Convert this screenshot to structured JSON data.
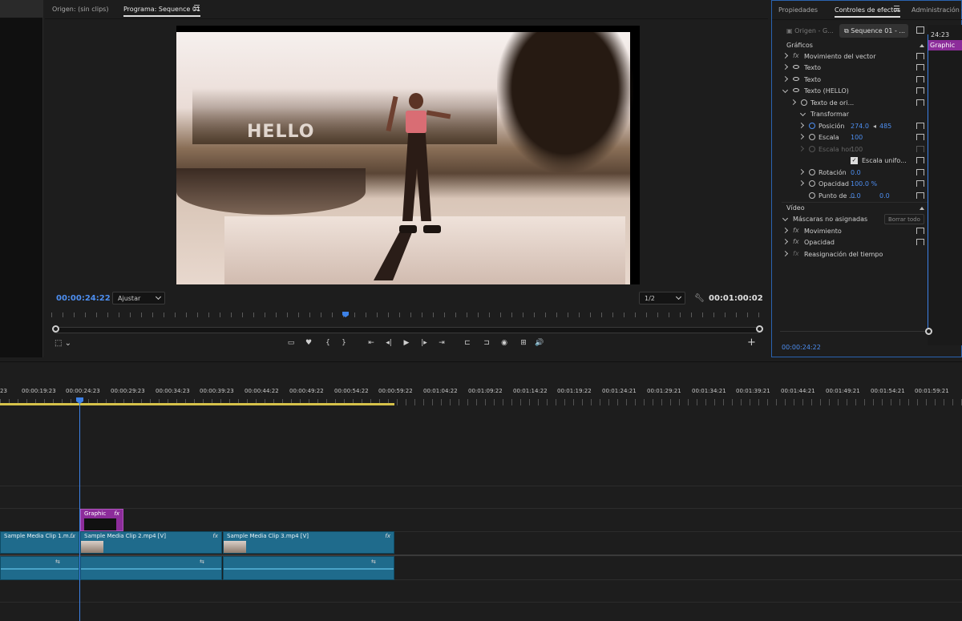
{
  "program": {
    "source_tab": "Origen: (sin clips)",
    "program_tab": "Programa: Sequence 01",
    "overlay_text": "HELLO",
    "current_time": "00:00:24:22",
    "fit_select": "Ajustar",
    "resolution_select": "1/2",
    "duration": "00:01:00:02",
    "controls": [
      "▭",
      "♥",
      "{",
      "}",
      "⇤",
      "◂|",
      "▶",
      "|▸",
      "⇥",
      "⊏",
      "⊐",
      "◉",
      "⊞",
      "🔊"
    ]
  },
  "effects": {
    "tabs": {
      "properties": "Propiedades",
      "effect_controls": "Controles de efectos",
      "admin": "Administración de"
    },
    "sub_source": "Origen - G...",
    "sub_sequence": "Sequence 01 - ...",
    "section_graphics": "Gráficos",
    "rows": [
      {
        "label": "Movimiento del vector"
      },
      {
        "label": "Texto"
      },
      {
        "label": "Texto"
      },
      {
        "label": "Texto (HELLO)"
      },
      {
        "label": "Texto de ori..."
      },
      {
        "label": "Transformar"
      },
      {
        "label": "Posición",
        "v1": "274.0",
        "v2": "485"
      },
      {
        "label": "Escala",
        "v1": "100"
      },
      {
        "label": "Escala hor...",
        "v1": "100"
      },
      {
        "label": "Escala unifo..."
      },
      {
        "label": "Rotación",
        "v1": "0.0"
      },
      {
        "label": "Opacidad",
        "v1": "100.0 %"
      },
      {
        "label": "Punto de ...",
        "v1": "0.0",
        "v2": "0.0"
      }
    ],
    "section_video": "Vídeo",
    "masks_label": "Máscaras no asignadas",
    "clear_all": "Borrar todo",
    "video_rows": [
      "Movimiento",
      "Opacidad",
      "Reasignación del tiempo"
    ],
    "timeline_time": "24:23",
    "graphic_label": "Graphic",
    "current_time": "00:00:24:22"
  },
  "timeline": {
    "ruler": [
      "23",
      "00:00:19:23",
      "00:00:24:23",
      "00:00:29:23",
      "00:00:34:23",
      "00:00:39:23",
      "00:00:44:22",
      "00:00:49:22",
      "00:00:54:22",
      "00:00:59:22",
      "00:01:04:22",
      "00:01:09:22",
      "00:01:14:22",
      "00:01:19:22",
      "00:01:24:21",
      "00:01:29:21",
      "00:01:34:21",
      "00:01:39:21",
      "00:01:44:21",
      "00:01:49:21",
      "00:01:54:21",
      "00:01:59:21"
    ],
    "graphic_clip": "Graphic",
    "clips": [
      "Sample Media Clip 1.m...",
      "Sample Media Clip 2.mp4 [V]",
      "Sample Media Clip 3.mp4 [V]"
    ],
    "fx": "fx"
  },
  "colors": {
    "accent": "#3d82e8",
    "clip": "#1f6b8c",
    "graphic": "#8c2c9a",
    "workarea": "#d6c24a"
  }
}
